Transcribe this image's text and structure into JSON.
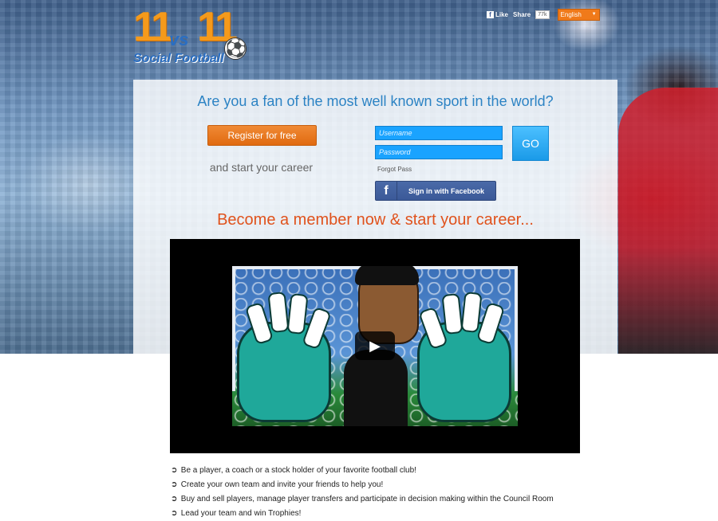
{
  "logo": {
    "number_left": "11",
    "vs": "vs",
    "number_right": "11",
    "tagline": "Social Football"
  },
  "social": {
    "like_label": "Like",
    "share_label": "Share",
    "share_count": "77k",
    "language": "English"
  },
  "headline": "Are you a fan of the most well known sport in the world?",
  "register": {
    "button_label": "Register for free",
    "subtext": "and start your career"
  },
  "login": {
    "username_placeholder": "Username",
    "password_placeholder": "Password",
    "go_label": "GO",
    "forgot_label": "Forgot Pass",
    "facebook_label": "Sign in with Facebook"
  },
  "subheadline": "Become a member now & start your career...",
  "video": {
    "play_icon": "play-icon"
  },
  "features": [
    "Be a player, a coach or a stock holder of your favorite football club!",
    "Create your own team and invite your friends to help you!",
    "Buy and sell players, manage player transfers and participate in decision making within the Council Room",
    "Lead your team and win Trophies!"
  ],
  "colors": {
    "accent_orange": "#e06a10",
    "accent_blue": "#2c83c4",
    "field_blue": "#1aa3ff",
    "facebook_blue": "#3b5998",
    "subhead_red": "#e0521c"
  }
}
